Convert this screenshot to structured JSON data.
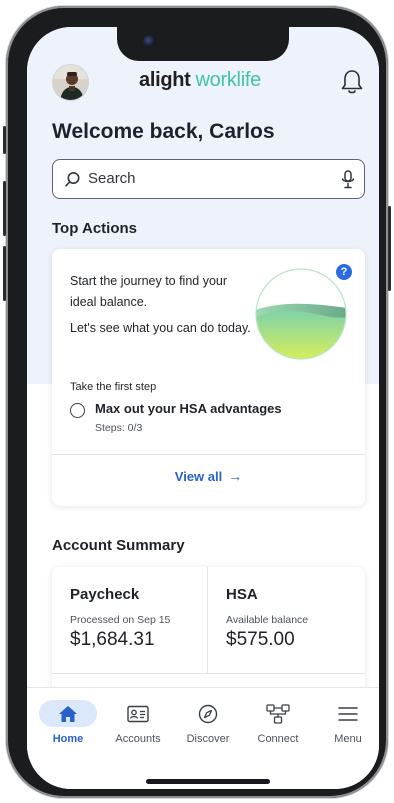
{
  "header": {
    "logo_primary": "alight",
    "logo_secondary": "worklife",
    "avatar_icon": "user-avatar",
    "notifications_icon": "bell-icon"
  },
  "welcome": "Welcome back, Carlos",
  "search": {
    "placeholder": "Search"
  },
  "top_actions": {
    "title": "Top Actions",
    "journey_line1": "Start the journey to find your ideal balance.",
    "journey_line2": "Let's see what you can do today.",
    "help_label": "?",
    "first_step_label": "Take the first step",
    "task_title": "Max out your HSA advantages",
    "task_steps": "Steps: 0/3",
    "view_all": "View all",
    "view_all_arrow": "→"
  },
  "account_summary": {
    "title": "Account Summary",
    "accounts": [
      {
        "name": "Paycheck",
        "subtitle": "Processed on Sep 15",
        "amount": "$1,684.31"
      },
      {
        "name": "HSA",
        "subtitle": "Available balance",
        "amount": "$575.00"
      }
    ]
  },
  "tabbar": {
    "items": [
      {
        "label": "Home",
        "icon": "home-icon",
        "active": true
      },
      {
        "label": "Accounts",
        "icon": "id-card-icon",
        "active": false
      },
      {
        "label": "Discover",
        "icon": "compass-icon",
        "active": false
      },
      {
        "label": "Connect",
        "icon": "network-icon",
        "active": false
      },
      {
        "label": "Menu",
        "icon": "hamburger-icon",
        "active": false
      }
    ]
  },
  "colors": {
    "accent_blue": "#2861c9",
    "brand_green": "#40c4a1",
    "help_badge": "#2a6de0",
    "active_tab_bg": "#dbe7fb"
  }
}
